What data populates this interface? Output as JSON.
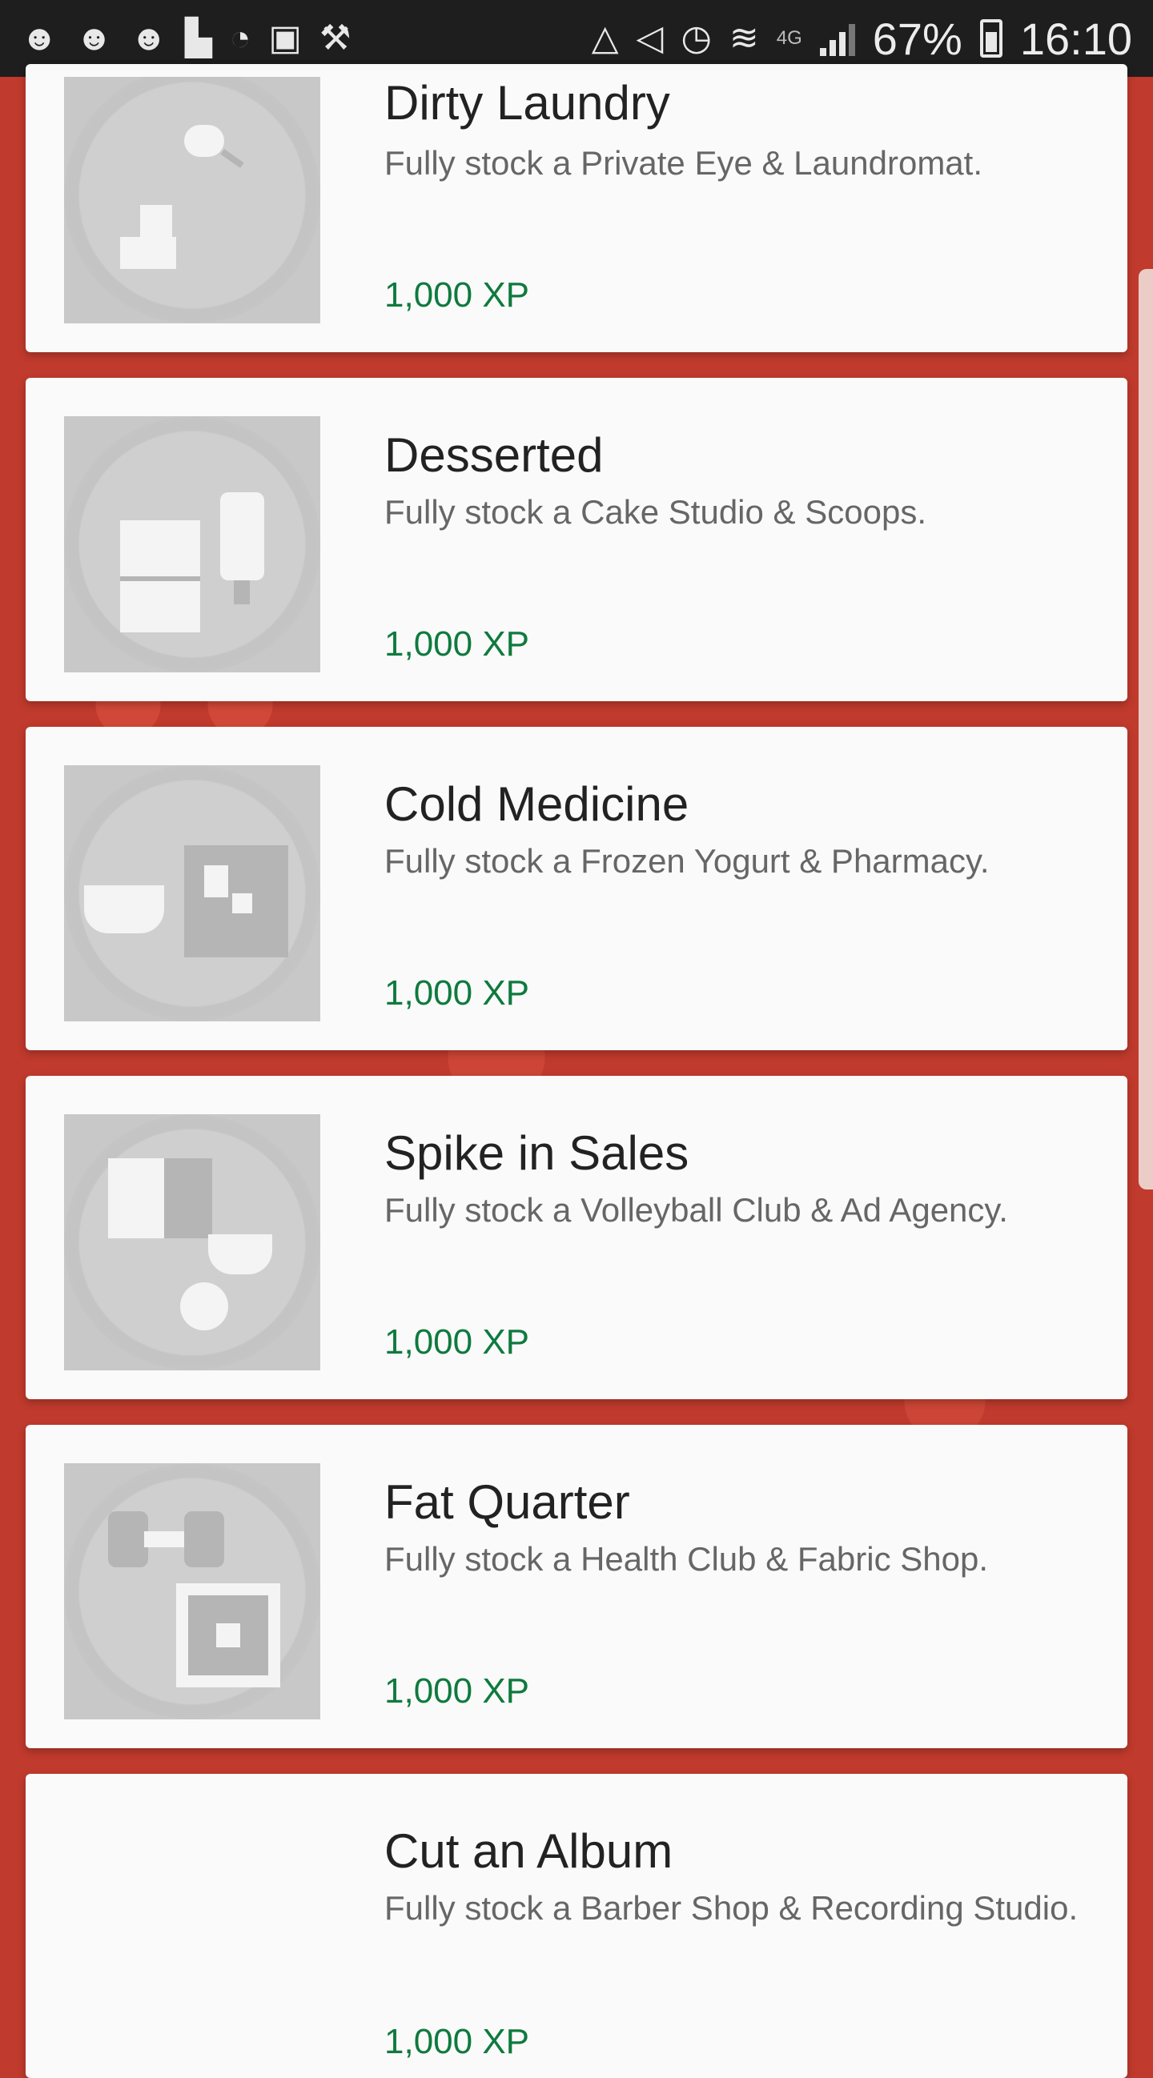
{
  "status_bar": {
    "left_icons": [
      "reddit-icon",
      "reddit-icon",
      "reddit-icon",
      "building-icon",
      "speedometer-icon",
      "image-icon",
      "pickaxe-icon"
    ],
    "right_icons": [
      "recycle-icon",
      "mute-icon",
      "alarm-icon",
      "wifi-icon",
      "signal-icon",
      "battery-icon"
    ],
    "network": "4G",
    "battery": "67%",
    "time": "16:10"
  },
  "achievements": [
    {
      "title": "Dirty Laundry",
      "description": "Fully stock a Private Eye & Laundromat.",
      "xp": "1,000 XP",
      "icon": "laundry-icon"
    },
    {
      "title": "Desserted",
      "description": "Fully stock a Cake Studio & Scoops.",
      "xp": "1,000 XP",
      "icon": "dessert-icon"
    },
    {
      "title": "Cold Medicine",
      "description": "Fully stock a Frozen Yogurt & Pharmacy.",
      "xp": "1,000 XP",
      "icon": "medicine-icon"
    },
    {
      "title": "Spike in Sales",
      "description": "Fully stock a Volleyball Club & Ad Agency.",
      "xp": "1,000 XP",
      "icon": "trophy-icon"
    },
    {
      "title": "Fat Quarter",
      "description": "Fully stock a Health Club & Fabric Shop.",
      "xp": "1,000 XP",
      "icon": "dumbbell-icon"
    },
    {
      "title": "Cut an Album",
      "description": "Fully stock a Barber Shop & Recording Studio.",
      "xp": "1,000 XP",
      "icon": "album-icon"
    }
  ],
  "colors": {
    "background": "#c03a2d",
    "card": "#fafafa",
    "xp": "#0f7a3e",
    "status_bar": "#1e1e1e"
  }
}
